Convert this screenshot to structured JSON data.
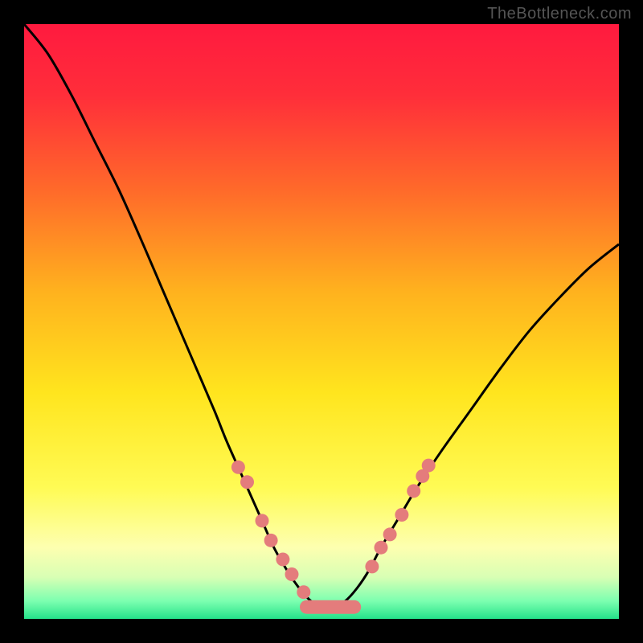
{
  "credit_text": "TheBottleneck.com",
  "background": {
    "stops": [
      {
        "offset": 0.0,
        "color": "#ff1a3f"
      },
      {
        "offset": 0.12,
        "color": "#ff2e3a"
      },
      {
        "offset": 0.28,
        "color": "#ff6a2a"
      },
      {
        "offset": 0.45,
        "color": "#ffb21e"
      },
      {
        "offset": 0.62,
        "color": "#ffe51e"
      },
      {
        "offset": 0.78,
        "color": "#fffb55"
      },
      {
        "offset": 0.88,
        "color": "#fdffb0"
      },
      {
        "offset": 0.93,
        "color": "#d8ffb4"
      },
      {
        "offset": 0.97,
        "color": "#7cffb0"
      },
      {
        "offset": 1.0,
        "color": "#24e28a"
      }
    ]
  },
  "chart_data": {
    "type": "line",
    "title": "",
    "xlabel": "",
    "ylabel": "",
    "xlim": [
      0,
      100
    ],
    "ylim": [
      0,
      100
    ],
    "series": [
      {
        "name": "bottleneck-curve",
        "x": [
          0,
          4,
          8,
          12,
          16,
          20,
          23,
          26,
          29,
          32,
          34,
          36,
          38,
          40,
          42,
          44,
          46,
          48,
          50,
          52,
          54,
          56,
          58,
          60,
          63,
          66,
          70,
          75,
          80,
          85,
          90,
          95,
          100
        ],
        "values": [
          100,
          95,
          88,
          80,
          72,
          63,
          56,
          49,
          42,
          35,
          30,
          25.5,
          21,
          16.5,
          12,
          8.5,
          5.5,
          3.2,
          1.9,
          1.9,
          3.0,
          5.2,
          8.2,
          12,
          17,
          22,
          28,
          35,
          42,
          48.5,
          54,
          59,
          63
        ]
      }
    ],
    "markers": [
      {
        "x": 36.0,
        "y": 25.5
      },
      {
        "x": 37.5,
        "y": 23.0
      },
      {
        "x": 40.0,
        "y": 16.5
      },
      {
        "x": 41.5,
        "y": 13.2
      },
      {
        "x": 43.5,
        "y": 10.0
      },
      {
        "x": 45.0,
        "y": 7.5
      },
      {
        "x": 47.0,
        "y": 4.5
      },
      {
        "x": 58.5,
        "y": 8.8
      },
      {
        "x": 60.0,
        "y": 12.0
      },
      {
        "x": 61.5,
        "y": 14.2
      },
      {
        "x": 63.5,
        "y": 17.5
      },
      {
        "x": 65.5,
        "y": 21.5
      },
      {
        "x": 67.0,
        "y": 24.0
      },
      {
        "x": 68.0,
        "y": 25.8
      }
    ],
    "flat_band": {
      "x0": 47.5,
      "x1": 55.5,
      "y": 2.0
    },
    "marker_color": "#e47c7c",
    "curve_color": "#000000"
  }
}
